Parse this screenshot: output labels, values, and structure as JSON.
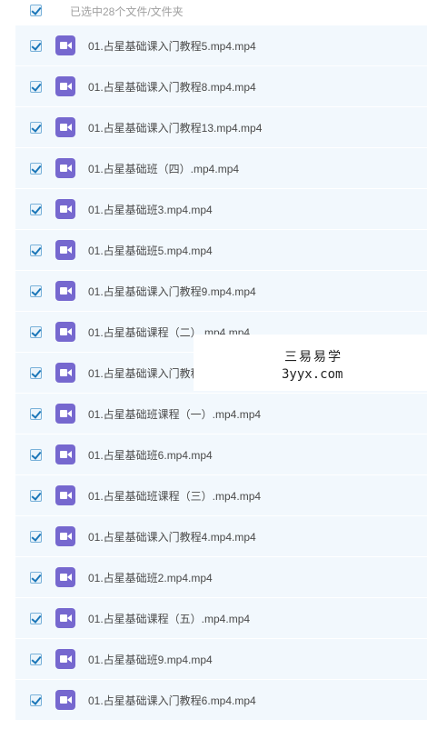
{
  "header": {
    "selected_text": "已选中28个文件/文件夹",
    "checked": true
  },
  "files": [
    {
      "name": "01.占星基础课入门教程5.mp4.mp4",
      "checked": true
    },
    {
      "name": "01.占星基础课入门教程8.mp4.mp4",
      "checked": true
    },
    {
      "name": "01.占星基础课入门教程13.mp4.mp4",
      "checked": true
    },
    {
      "name": "01.占星基础班（四）.mp4.mp4",
      "checked": true
    },
    {
      "name": "01.占星基础班3.mp4.mp4",
      "checked": true
    },
    {
      "name": "01.占星基础班5.mp4.mp4",
      "checked": true
    },
    {
      "name": "01.占星基础课入门教程9.mp4.mp4",
      "checked": true
    },
    {
      "name": "01.占星基础课程（二）.mp4.mp4",
      "checked": true
    },
    {
      "name": "01.占星基础课入门教程",
      "checked": true
    },
    {
      "name": "01.占星基础班课程（一）.mp4.mp4",
      "checked": true
    },
    {
      "name": "01.占星基础班6.mp4.mp4",
      "checked": true
    },
    {
      "name": "01.占星基础班课程（三）.mp4.mp4",
      "checked": true
    },
    {
      "name": "01.占星基础课入门教程4.mp4.mp4",
      "checked": true
    },
    {
      "name": "01.占星基础班2.mp4.mp4",
      "checked": true
    },
    {
      "name": "01.占星基础课程（五）.mp4.mp4",
      "checked": true
    },
    {
      "name": "01.占星基础班9.mp4.mp4",
      "checked": true
    },
    {
      "name": "01.占星基础课入门教程6.mp4.mp4",
      "checked": true
    }
  ],
  "file_icon": "video-file-icon",
  "colors": {
    "row_bg": "#f2f8fd",
    "icon_bg": "#7668cf",
    "check": "#1a76b8"
  },
  "watermark": {
    "line1": "三易易学",
    "line2": "3yyx.com"
  }
}
